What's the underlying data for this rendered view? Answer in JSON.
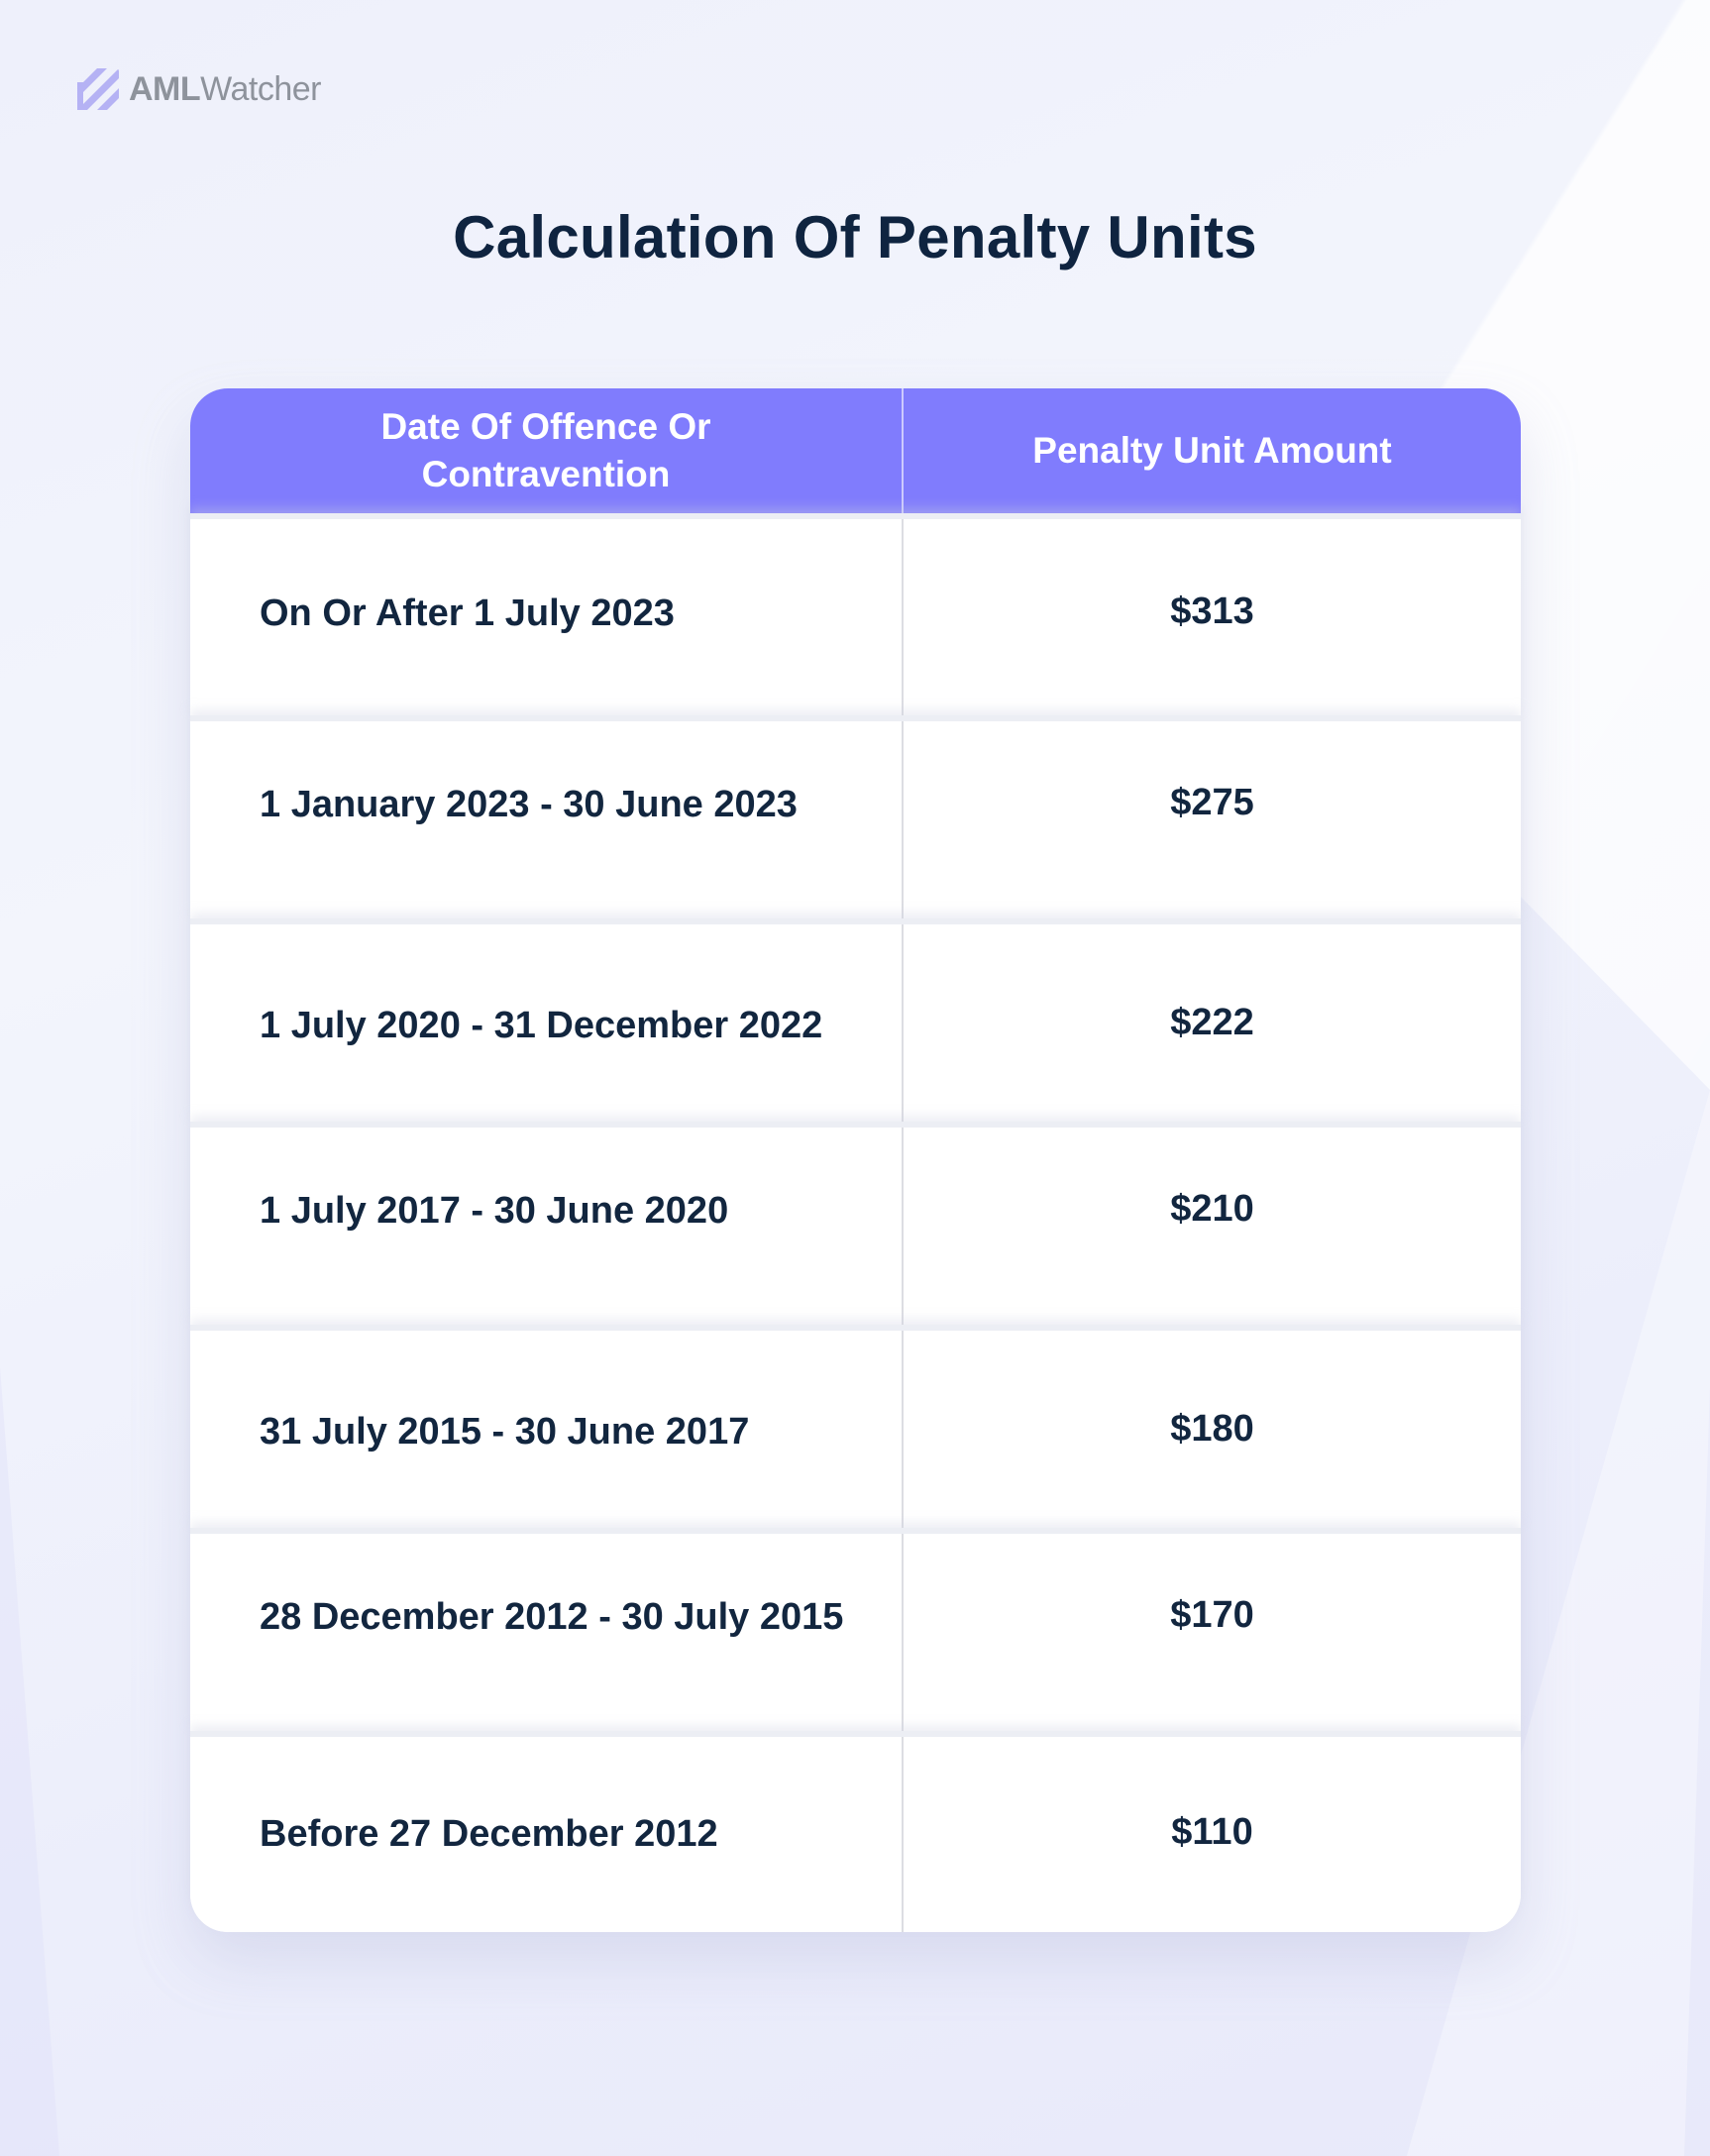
{
  "brand": {
    "name_strong": "AML",
    "name_light": "Watcher",
    "logo_icon": "striped-square-logo-icon",
    "logo_color": "#b5b2f4"
  },
  "title": "Calculation Of Penalty Units",
  "colors": {
    "header_bg": "#807cfd",
    "text_dark": "#12263f",
    "background": "#eef0fb"
  },
  "table": {
    "headers": [
      "Date Of Offence Or Contravention",
      "Penalty Unit Amount"
    ],
    "rows": [
      {
        "date": "On Or After 1 July 2023",
        "amount": "$313"
      },
      {
        "date": "1 January 2023 - 30 June 2023",
        "amount": "$275"
      },
      {
        "date": "1 July 2020 - 31 December 2022",
        "amount": "$222"
      },
      {
        "date": "1 July 2017 - 30 June 2020",
        "amount": "$210"
      },
      {
        "date": "31 July 2015 - 30 June 2017",
        "amount": "$180"
      },
      {
        "date": "28 December 2012 - 30 July 2015",
        "amount": "$170"
      },
      {
        "date": "Before 27 December 2012",
        "amount": "$110"
      }
    ]
  }
}
